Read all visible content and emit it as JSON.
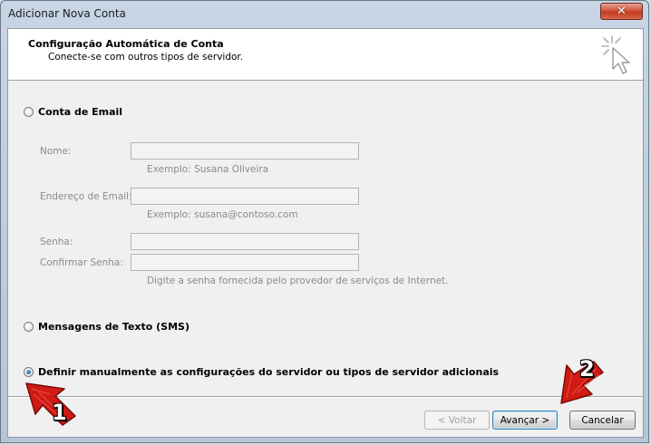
{
  "window": {
    "title": "Adicionar Nova Conta",
    "close_label": "✕"
  },
  "header": {
    "title": "Configuração Automática de Conta",
    "subtitle": "Conecte-se com outros tipos de servidor.",
    "icon": "wizard-cursor-icon"
  },
  "options": {
    "email_account": {
      "label": "Conta de Email",
      "selected": false
    },
    "sms": {
      "label": "Mensagens de Texto (SMS)",
      "selected": false
    },
    "manual": {
      "label": "Definir manualmente as configurações do servidor ou tipos de servidor adicionais",
      "selected": true
    }
  },
  "form": {
    "name": {
      "label": "Nome:",
      "value": "",
      "hint": "Exemplo: Susana Oliveira"
    },
    "email": {
      "label": "Endereço de Email:",
      "value": "",
      "hint": "Exemplo: susana@contoso.com"
    },
    "password": {
      "label": "Senha:",
      "value": ""
    },
    "confirm_password": {
      "label": "Confirmar Senha:",
      "value": ""
    },
    "password_hint": "Digite a senha fornecida pelo provedor de serviços de Internet."
  },
  "buttons": {
    "back": "< Voltar",
    "next": "Avançar >",
    "cancel": "Cancelar"
  },
  "annotations": {
    "marker_1": "1",
    "marker_2": "2",
    "color": "#d11a14"
  }
}
